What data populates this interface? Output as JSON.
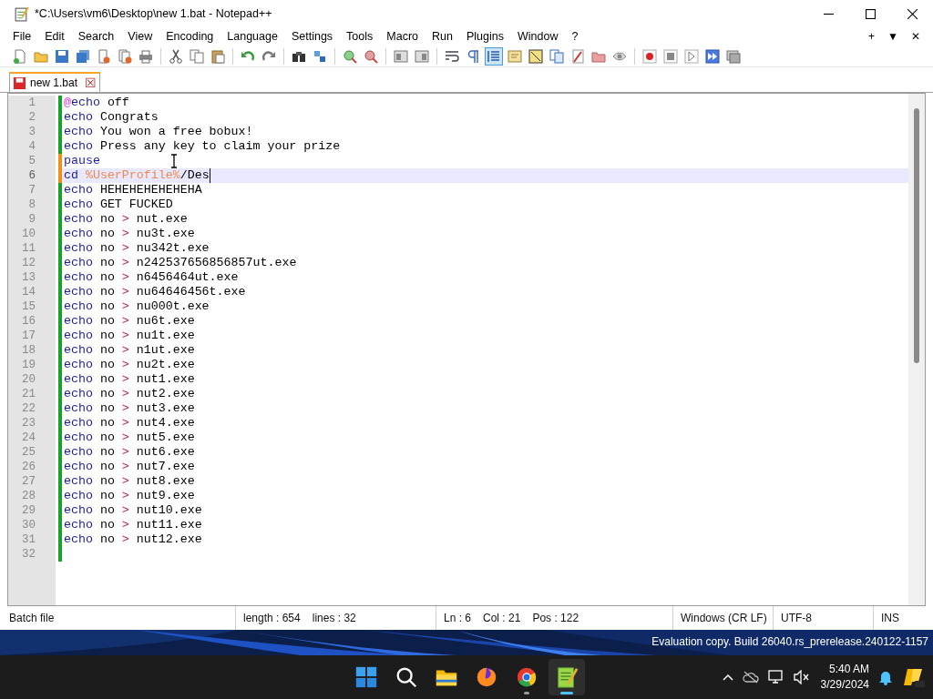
{
  "window": {
    "title": "*C:\\Users\\vm6\\Desktop\\new 1.bat - Notepad++"
  },
  "menu": [
    "File",
    "Edit",
    "Search",
    "View",
    "Encoding",
    "Language",
    "Settings",
    "Tools",
    "Macro",
    "Run",
    "Plugins",
    "Window",
    "?"
  ],
  "menu_right": [
    "+",
    "▼",
    "✕"
  ],
  "toolbar": [
    {
      "kind": "new",
      "on": false
    },
    {
      "kind": "open",
      "on": false
    },
    {
      "kind": "save",
      "on": false
    },
    {
      "kind": "save-all",
      "on": false
    },
    {
      "kind": "close",
      "on": false
    },
    {
      "kind": "close-all",
      "on": false
    },
    {
      "kind": "print",
      "on": false
    },
    {
      "kind": "sep"
    },
    {
      "kind": "cut",
      "on": false
    },
    {
      "kind": "copy",
      "on": false
    },
    {
      "kind": "paste",
      "on": false
    },
    {
      "kind": "sep"
    },
    {
      "kind": "undo",
      "on": false
    },
    {
      "kind": "redo",
      "on": false
    },
    {
      "kind": "sep"
    },
    {
      "kind": "find",
      "on": false
    },
    {
      "kind": "replace",
      "on": false
    },
    {
      "kind": "sep"
    },
    {
      "kind": "zoom-in",
      "on": false
    },
    {
      "kind": "zoom-out",
      "on": false
    },
    {
      "kind": "sep"
    },
    {
      "kind": "sync-v",
      "on": false
    },
    {
      "kind": "sync-h",
      "on": false
    },
    {
      "kind": "sep"
    },
    {
      "kind": "wrap",
      "on": false
    },
    {
      "kind": "all-chars",
      "on": false
    },
    {
      "kind": "indent-guide",
      "on": true
    },
    {
      "kind": "lang",
      "on": false
    },
    {
      "kind": "doc-map",
      "on": false
    },
    {
      "kind": "doc-list",
      "on": false
    },
    {
      "kind": "function-list",
      "on": false
    },
    {
      "kind": "folder",
      "on": false
    },
    {
      "kind": "monitor",
      "on": false
    },
    {
      "kind": "sep"
    },
    {
      "kind": "record",
      "on": false
    },
    {
      "kind": "stop",
      "on": false
    },
    {
      "kind": "play",
      "on": false
    },
    {
      "kind": "play-multi",
      "on": false
    },
    {
      "kind": "save-macro",
      "on": false
    }
  ],
  "tabs": [
    {
      "label": "new 1.bat",
      "selected": true,
      "modified": true,
      "close": "☒"
    }
  ],
  "editor": {
    "lines": [
      {
        "number": "1",
        "modified": false,
        "current": false,
        "tokens": [
          {
            "kind": "at",
            "text": "@"
          },
          {
            "kind": "keyword",
            "text": "echo"
          },
          {
            "kind": "text",
            "text": " off"
          }
        ]
      },
      {
        "number": "2",
        "modified": false,
        "current": false,
        "tokens": [
          {
            "kind": "keyword",
            "text": "echo"
          },
          {
            "kind": "text",
            "text": " Congrats"
          }
        ]
      },
      {
        "number": "3",
        "modified": false,
        "current": false,
        "tokens": [
          {
            "kind": "keyword",
            "text": "echo"
          },
          {
            "kind": "text",
            "text": " You won a free bobux!"
          }
        ]
      },
      {
        "number": "4",
        "modified": false,
        "current": false,
        "tokens": [
          {
            "kind": "keyword",
            "text": "echo"
          },
          {
            "kind": "text",
            "text": " Press any key to claim your prize"
          }
        ]
      },
      {
        "number": "5",
        "modified": true,
        "current": false,
        "tokens": [
          {
            "kind": "keyword",
            "text": "pause"
          }
        ]
      },
      {
        "number": "6",
        "modified": true,
        "current": true,
        "tokens": [
          {
            "kind": "keyword",
            "text": "cd "
          },
          {
            "kind": "variable",
            "text": "%UserProfile%"
          },
          {
            "kind": "text",
            "text": "/Des"
          }
        ]
      },
      {
        "number": "7",
        "modified": false,
        "current": false,
        "tokens": [
          {
            "kind": "keyword",
            "text": "echo"
          },
          {
            "kind": "text",
            "text": " HEHEHEHEHEHEHA"
          }
        ]
      },
      {
        "number": "8",
        "modified": false,
        "current": false,
        "tokens": [
          {
            "kind": "keyword",
            "text": "echo"
          },
          {
            "kind": "text",
            "text": " GET FUCKED"
          }
        ]
      },
      {
        "number": "9",
        "modified": false,
        "current": false,
        "tokens": [
          {
            "kind": "keyword",
            "text": "echo"
          },
          {
            "kind": "text",
            "text": " no "
          },
          {
            "kind": "operator",
            "text": ">"
          },
          {
            "kind": "text",
            "text": " nut.exe"
          }
        ]
      },
      {
        "number": "10",
        "modified": false,
        "current": false,
        "tokens": [
          {
            "kind": "keyword",
            "text": "echo"
          },
          {
            "kind": "text",
            "text": " no "
          },
          {
            "kind": "operator",
            "text": ">"
          },
          {
            "kind": "text",
            "text": " nu3t.exe"
          }
        ]
      },
      {
        "number": "11",
        "modified": false,
        "current": false,
        "tokens": [
          {
            "kind": "keyword",
            "text": "echo"
          },
          {
            "kind": "text",
            "text": " no "
          },
          {
            "kind": "operator",
            "text": ">"
          },
          {
            "kind": "text",
            "text": " nu342t.exe"
          }
        ]
      },
      {
        "number": "12",
        "modified": false,
        "current": false,
        "tokens": [
          {
            "kind": "keyword",
            "text": "echo"
          },
          {
            "kind": "text",
            "text": " no "
          },
          {
            "kind": "operator",
            "text": ">"
          },
          {
            "kind": "text",
            "text": " n242537656856857ut.exe"
          }
        ]
      },
      {
        "number": "13",
        "modified": false,
        "current": false,
        "tokens": [
          {
            "kind": "keyword",
            "text": "echo"
          },
          {
            "kind": "text",
            "text": " no "
          },
          {
            "kind": "operator",
            "text": ">"
          },
          {
            "kind": "text",
            "text": " n6456464ut.exe"
          }
        ]
      },
      {
        "number": "14",
        "modified": false,
        "current": false,
        "tokens": [
          {
            "kind": "keyword",
            "text": "echo"
          },
          {
            "kind": "text",
            "text": " no "
          },
          {
            "kind": "operator",
            "text": ">"
          },
          {
            "kind": "text",
            "text": " nu64646456t.exe"
          }
        ]
      },
      {
        "number": "15",
        "modified": false,
        "current": false,
        "tokens": [
          {
            "kind": "keyword",
            "text": "echo"
          },
          {
            "kind": "text",
            "text": " no "
          },
          {
            "kind": "operator",
            "text": ">"
          },
          {
            "kind": "text",
            "text": " nu000t.exe"
          }
        ]
      },
      {
        "number": "16",
        "modified": false,
        "current": false,
        "tokens": [
          {
            "kind": "keyword",
            "text": "echo"
          },
          {
            "kind": "text",
            "text": " no "
          },
          {
            "kind": "operator",
            "text": ">"
          },
          {
            "kind": "text",
            "text": " nu6t.exe"
          }
        ]
      },
      {
        "number": "17",
        "modified": false,
        "current": false,
        "tokens": [
          {
            "kind": "keyword",
            "text": "echo"
          },
          {
            "kind": "text",
            "text": " no "
          },
          {
            "kind": "operator",
            "text": ">"
          },
          {
            "kind": "text",
            "text": " nu1t.exe"
          }
        ]
      },
      {
        "number": "18",
        "modified": false,
        "current": false,
        "tokens": [
          {
            "kind": "keyword",
            "text": "echo"
          },
          {
            "kind": "text",
            "text": " no "
          },
          {
            "kind": "operator",
            "text": ">"
          },
          {
            "kind": "text",
            "text": " n1ut.exe"
          }
        ]
      },
      {
        "number": "19",
        "modified": false,
        "current": false,
        "tokens": [
          {
            "kind": "keyword",
            "text": "echo"
          },
          {
            "kind": "text",
            "text": " no "
          },
          {
            "kind": "operator",
            "text": ">"
          },
          {
            "kind": "text",
            "text": " nu2t.exe"
          }
        ]
      },
      {
        "number": "20",
        "modified": false,
        "current": false,
        "tokens": [
          {
            "kind": "keyword",
            "text": "echo"
          },
          {
            "kind": "text",
            "text": " no "
          },
          {
            "kind": "operator",
            "text": ">"
          },
          {
            "kind": "text",
            "text": " nut1.exe"
          }
        ]
      },
      {
        "number": "21",
        "modified": false,
        "current": false,
        "tokens": [
          {
            "kind": "keyword",
            "text": "echo"
          },
          {
            "kind": "text",
            "text": " no "
          },
          {
            "kind": "operator",
            "text": ">"
          },
          {
            "kind": "text",
            "text": " nut2.exe"
          }
        ]
      },
      {
        "number": "22",
        "modified": false,
        "current": false,
        "tokens": [
          {
            "kind": "keyword",
            "text": "echo"
          },
          {
            "kind": "text",
            "text": " no "
          },
          {
            "kind": "operator",
            "text": ">"
          },
          {
            "kind": "text",
            "text": " nut3.exe"
          }
        ]
      },
      {
        "number": "23",
        "modified": false,
        "current": false,
        "tokens": [
          {
            "kind": "keyword",
            "text": "echo"
          },
          {
            "kind": "text",
            "text": " no "
          },
          {
            "kind": "operator",
            "text": ">"
          },
          {
            "kind": "text",
            "text": " nut4.exe"
          }
        ]
      },
      {
        "number": "24",
        "modified": false,
        "current": false,
        "tokens": [
          {
            "kind": "keyword",
            "text": "echo"
          },
          {
            "kind": "text",
            "text": " no "
          },
          {
            "kind": "operator",
            "text": ">"
          },
          {
            "kind": "text",
            "text": " nut5.exe"
          }
        ]
      },
      {
        "number": "25",
        "modified": false,
        "current": false,
        "tokens": [
          {
            "kind": "keyword",
            "text": "echo"
          },
          {
            "kind": "text",
            "text": " no "
          },
          {
            "kind": "operator",
            "text": ">"
          },
          {
            "kind": "text",
            "text": " nut6.exe"
          }
        ]
      },
      {
        "number": "26",
        "modified": false,
        "current": false,
        "tokens": [
          {
            "kind": "keyword",
            "text": "echo"
          },
          {
            "kind": "text",
            "text": " no "
          },
          {
            "kind": "operator",
            "text": ">"
          },
          {
            "kind": "text",
            "text": " nut7.exe"
          }
        ]
      },
      {
        "number": "27",
        "modified": false,
        "current": false,
        "tokens": [
          {
            "kind": "keyword",
            "text": "echo"
          },
          {
            "kind": "text",
            "text": " no "
          },
          {
            "kind": "operator",
            "text": ">"
          },
          {
            "kind": "text",
            "text": " nut8.exe"
          }
        ]
      },
      {
        "number": "28",
        "modified": false,
        "current": false,
        "tokens": [
          {
            "kind": "keyword",
            "text": "echo"
          },
          {
            "kind": "text",
            "text": " no "
          },
          {
            "kind": "operator",
            "text": ">"
          },
          {
            "kind": "text",
            "text": " nut9.exe"
          }
        ]
      },
      {
        "number": "29",
        "modified": false,
        "current": false,
        "tokens": [
          {
            "kind": "keyword",
            "text": "echo"
          },
          {
            "kind": "text",
            "text": " no "
          },
          {
            "kind": "operator",
            "text": ">"
          },
          {
            "kind": "text",
            "text": " nut10.exe"
          }
        ]
      },
      {
        "number": "30",
        "modified": false,
        "current": false,
        "tokens": [
          {
            "kind": "keyword",
            "text": "echo"
          },
          {
            "kind": "text",
            "text": " no "
          },
          {
            "kind": "operator",
            "text": ">"
          },
          {
            "kind": "text",
            "text": " nut11.exe"
          }
        ]
      },
      {
        "number": "31",
        "modified": false,
        "current": false,
        "tokens": [
          {
            "kind": "keyword",
            "text": "echo"
          },
          {
            "kind": "text",
            "text": " no "
          },
          {
            "kind": "operator",
            "text": ">"
          },
          {
            "kind": "text",
            "text": " nut12.exe"
          }
        ]
      },
      {
        "number": "32",
        "modified": false,
        "current": false
      }
    ]
  },
  "status_bar": [
    {
      "texts": [
        "Batch file"
      ]
    },
    {
      "texts": [
        "length : 654",
        "lines : 32"
      ]
    },
    {
      "texts": [
        "Ln : 6",
        "Col : 21",
        "Pos : 122"
      ]
    },
    {
      "texts": [
        "Windows (CR LF)"
      ]
    },
    {
      "texts": [
        "UTF-8"
      ]
    },
    {
      "texts": [
        "INS"
      ]
    }
  ],
  "desktop": {
    "watermark": [
      "Evaluation copy. Build 26040.rs_prerelease.240122-1157"
    ]
  },
  "taskbar": {
    "apps": [
      {
        "kind": "start",
        "active": false,
        "running": false
      },
      {
        "kind": "search",
        "active": false,
        "running": false
      },
      {
        "kind": "files",
        "active": false,
        "running": false
      },
      {
        "kind": "firefox",
        "active": false,
        "running": false
      },
      {
        "kind": "chrome",
        "active": false,
        "running": true
      },
      {
        "kind": "notepad",
        "active": true,
        "running": true
      }
    ],
    "time": "5:40 AM",
    "date": "3/29/2024"
  }
}
